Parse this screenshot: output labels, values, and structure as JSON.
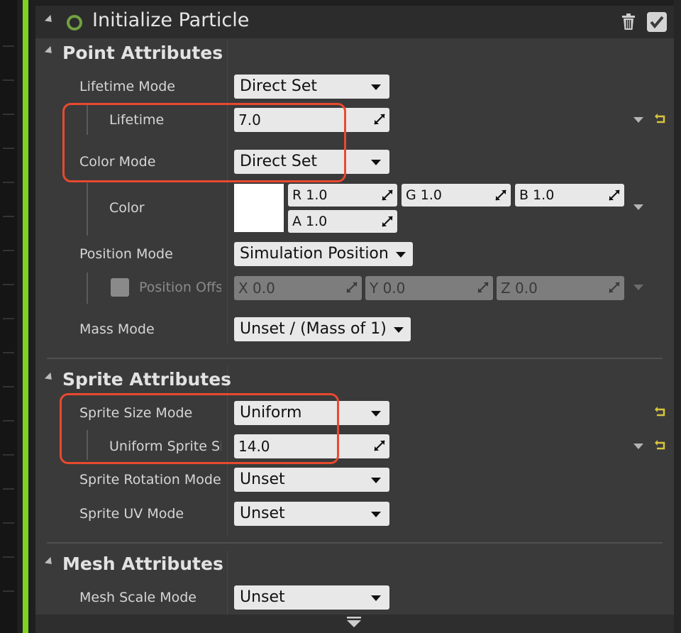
{
  "module": {
    "title": "Initialize Particle",
    "ring_color": "#71a142",
    "accent_color": "#7ed321",
    "icons": {
      "delete": "trash-icon",
      "enabled": "checkmark-icon"
    }
  },
  "sections": {
    "point": {
      "title": "Point Attributes",
      "lifetime_mode": {
        "label": "Lifetime Mode",
        "value": "Direct Set"
      },
      "lifetime": {
        "label": "Lifetime",
        "value": "7.0"
      },
      "color_mode": {
        "label": "Color Mode",
        "value": "Direct Set"
      },
      "color": {
        "label": "Color",
        "swatch": "#ffffff",
        "r": "R 1.0",
        "g": "G 1.0",
        "b": "B 1.0",
        "a": "A 1.0"
      },
      "position_mode": {
        "label": "Position Mode",
        "value": "Simulation Position"
      },
      "position_offset": {
        "label": "Position Offs",
        "x": "X 0.0",
        "y": "Y 0.0",
        "z": "Z 0.0"
      },
      "mass_mode": {
        "label": "Mass Mode",
        "value": "Unset / (Mass of 1)"
      }
    },
    "sprite": {
      "title": "Sprite Attributes",
      "size_mode": {
        "label": "Sprite Size Mode",
        "value": "Uniform"
      },
      "uniform_size": {
        "label": "Uniform Sprite Si",
        "value": "14.0"
      },
      "rotation_mode": {
        "label": "Sprite Rotation Mode",
        "value": "Unset"
      },
      "uv_mode": {
        "label": "Sprite UV Mode",
        "value": "Unset"
      }
    },
    "mesh": {
      "title": "Mesh Attributes",
      "scale_mode": {
        "label": "Mesh Scale Mode",
        "value": "Unset"
      }
    }
  },
  "highlight_color": "#e8492f"
}
